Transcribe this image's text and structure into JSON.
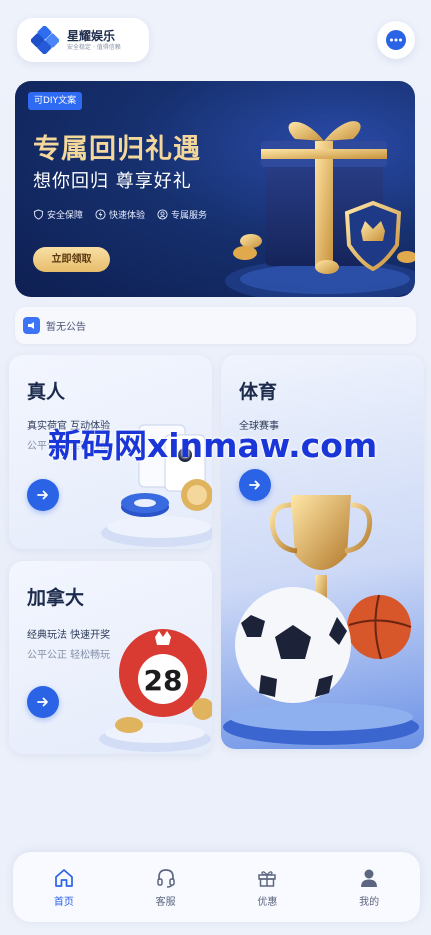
{
  "header": {
    "brand_name": "星耀娱乐",
    "brand_slogan": "安全稳定 · 值得信赖",
    "message_icon": "chat-bubble-icon"
  },
  "banner": {
    "tag": "可DIY文案",
    "title": "专属回归礼遇",
    "subtitle": "想你回归 尊享好礼",
    "features": [
      {
        "icon": "shield-icon",
        "label": "安全保障"
      },
      {
        "icon": "lightning-icon",
        "label": "快速体验"
      },
      {
        "icon": "user-icon",
        "label": "专属服务"
      }
    ],
    "cta": "立即领取"
  },
  "notice": {
    "text": "暂无公告"
  },
  "cards": {
    "live": {
      "title": "真人",
      "line1": "真实荷官 互动体验",
      "line2": "公平公正 实时对战"
    },
    "sports": {
      "title": "体育",
      "line1": "全球赛事"
    },
    "canada": {
      "title": "加拿大",
      "line1": "经典玩法 快速开奖",
      "line2": "公平公正 轻松畅玩",
      "ball_number": "28"
    }
  },
  "watermark": "新码网xinmaw.com",
  "bottom_nav": [
    {
      "label": "首页",
      "icon": "home-icon",
      "active": true
    },
    {
      "label": "客服",
      "icon": "headset-icon",
      "active": false
    },
    {
      "label": "优惠",
      "icon": "gift-icon",
      "active": false
    },
    {
      "label": "我的",
      "icon": "profile-icon",
      "active": false
    }
  ],
  "colors": {
    "accent": "#2a63e6",
    "banner_bg": "#16306e",
    "gold": "#f4d79a"
  }
}
